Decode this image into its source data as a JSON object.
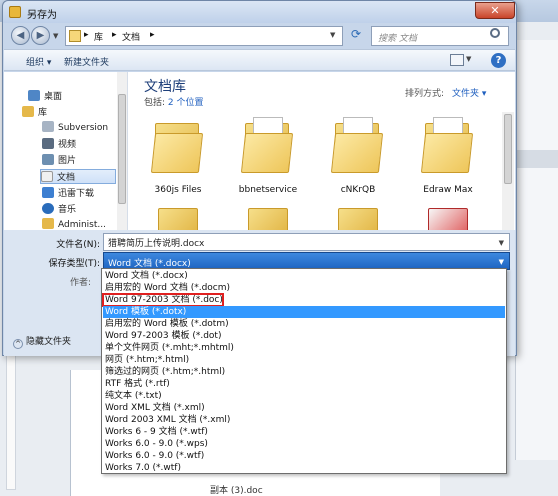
{
  "dialog": {
    "title": "另存为",
    "close": "✕"
  },
  "address": {
    "crumbs": [
      "库",
      "▸",
      "文档",
      "▸"
    ],
    "search_placeholder": "搜索 文档"
  },
  "toolbar": {
    "organize": "组织 ▾",
    "new_folder": "新建文件夹",
    "help": "?"
  },
  "nav": {
    "items": [
      {
        "label": "桌面"
      },
      {
        "label": "库"
      },
      {
        "label": "Subversion"
      },
      {
        "label": "视频"
      },
      {
        "label": "图片"
      },
      {
        "label": "文档"
      },
      {
        "label": "迅雷下载"
      },
      {
        "label": "音乐"
      },
      {
        "label": "Administ..."
      }
    ]
  },
  "library": {
    "title": "文档库",
    "includes_prefix": "包括: ",
    "includes_link": "2 个位置",
    "arrange_label": "排列方式:",
    "arrange_value": "文件夹 ▾"
  },
  "folders": [
    "360js Files",
    "bbnetservice",
    "cNKrQB",
    "Edraw Max"
  ],
  "form": {
    "filename_label": "文件名(N):",
    "filename_value": "猎聘简历上传说明.docx",
    "filetype_label": "保存类型(T):",
    "filetype_value": "Word 文档 (*.docx)",
    "authors_label": "作者:",
    "hide_folders": "隐藏文件夹"
  },
  "filetype_options": [
    "Word 文档 (*.docx)",
    "启用宏的 Word 文档 (*.docm)",
    "Word 97-2003 文档 (*.doc)",
    "Word 模板 (*.dotx)",
    "启用宏的 Word 模板 (*.dotm)",
    "Word 97-2003 模板 (*.dot)",
    "单个文件网页 (*.mht;*.mhtml)",
    "网页 (*.htm;*.html)",
    "筛选过的网页 (*.htm;*.html)",
    "RTF 格式 (*.rtf)",
    "纯文本 (*.txt)",
    "Word XML 文档 (*.xml)",
    "Word 2003 XML 文档 (*.xml)",
    "Works 6 - 9 文档 (*.wtf)",
    "Works 6.0 - 9.0 (*.wps)",
    "Works 6.0 - 9.0 (*.wtf)",
    "Works 7.0 (*.wtf)"
  ],
  "background": {
    "doc_item_1": "(3).doc",
    "doc_item_2": "副本 (3).doc"
  }
}
